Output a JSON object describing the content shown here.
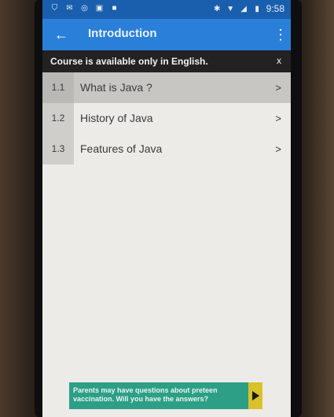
{
  "status_bar": {
    "time": "9:58",
    "left_icons": [
      "shield-icon",
      "mail-icon",
      "sync-icon",
      "lock-icon",
      "notification-icon"
    ],
    "right_icons": [
      "bluetooth-icon",
      "wifi-icon",
      "signal-icon",
      "battery-icon"
    ]
  },
  "app_bar": {
    "back_glyph": "←",
    "title": "Introduction",
    "overflow_glyph": "⋮"
  },
  "banner": {
    "text": "Course is available only in English.",
    "close_glyph": "x"
  },
  "lessons": [
    {
      "number": "1.1",
      "title": "What is Java ?",
      "chevron": ">"
    },
    {
      "number": "1.2",
      "title": "History of Java",
      "chevron": ">"
    },
    {
      "number": "1.3",
      "title": "Features of Java",
      "chevron": ">"
    }
  ],
  "ad": {
    "line1": "Parents may have questions about preteen",
    "line2": "vaccination. Will you have the answers?"
  },
  "colors": {
    "status_bar": "#1a5fae",
    "app_bar": "#2a80d8",
    "banner": "#222222",
    "ad": "#2c9f86"
  }
}
